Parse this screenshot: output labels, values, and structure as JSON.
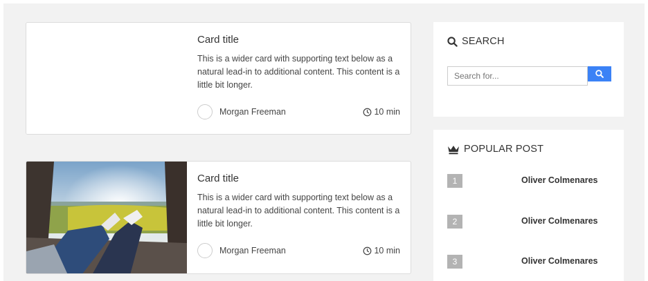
{
  "cards": [
    {
      "title": "Card title",
      "text": "This is a wider card with supporting text below as a natural lead-in to additional content. This content is a little bit longer.",
      "author": "Morgan Freeman",
      "time": "10 min",
      "image": "blank"
    },
    {
      "title": "Card title",
      "text": "This is a wider card with supporting text below as a natural lead-in to additional content. This content is a little bit longer.",
      "author": "Morgan Freeman",
      "time": "10 min",
      "image": "photo of legs and feet relaxing in car trunk overlooking a field"
    }
  ],
  "sidebar": {
    "search": {
      "title": "SEARCH",
      "placeholder": "Search for...",
      "icon": "search-icon"
    },
    "popular": {
      "title": "POPULAR POST",
      "icon": "crown-icon",
      "items": [
        {
          "num": "1",
          "name": "Oliver Colmenares"
        },
        {
          "num": "2",
          "name": "Oliver Colmenares"
        },
        {
          "num": "3",
          "name": "Oliver Colmenares"
        }
      ]
    }
  },
  "colors": {
    "background": "#f2f2f2",
    "accent": "#3b82f6",
    "badge": "#b3b3b3"
  }
}
